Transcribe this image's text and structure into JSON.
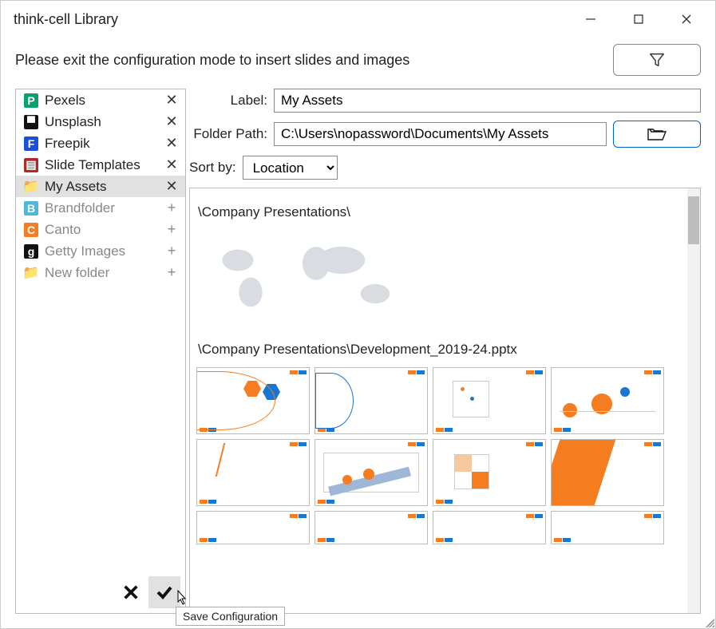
{
  "window": {
    "title": "think-cell Library"
  },
  "instruction": "Please exit the configuration mode to insert slides and images",
  "sidebar": {
    "items": [
      {
        "label": "Pexels",
        "icon_bg": "#0aa06e",
        "icon_char": "P",
        "action": "✕",
        "dim": false,
        "selected": false
      },
      {
        "label": "Unsplash",
        "icon_bg": "#111111",
        "icon_char": "▀",
        "action": "✕",
        "dim": false,
        "selected": false
      },
      {
        "label": "Freepik",
        "icon_bg": "#1e4fd8",
        "icon_char": "F",
        "action": "✕",
        "dim": false,
        "selected": false
      },
      {
        "label": "Slide Templates",
        "icon_bg": "#b02a2a",
        "icon_char": "▤",
        "action": "✕",
        "dim": false,
        "selected": false
      },
      {
        "label": "My Assets",
        "icon_bg": "#f5c04a",
        "icon_char": "📁",
        "action": "✕",
        "dim": false,
        "selected": true
      },
      {
        "label": "Brandfolder",
        "icon_bg": "#4fb7d9",
        "icon_char": "B",
        "action": "+",
        "dim": true,
        "selected": false
      },
      {
        "label": "Canto",
        "icon_bg": "#f57c1f",
        "icon_char": "C",
        "action": "+",
        "dim": true,
        "selected": false
      },
      {
        "label": "Getty Images",
        "icon_bg": "#111111",
        "icon_char": "g",
        "action": "+",
        "dim": true,
        "selected": false
      },
      {
        "label": "New folder",
        "icon_bg": "#f5c04a",
        "icon_char": "📁",
        "action": "+",
        "dim": true,
        "selected": false
      }
    ]
  },
  "fields": {
    "label_caption": "Label:",
    "label_value": "My Assets",
    "path_caption": "Folder Path:",
    "path_value": "C:\\Users\\nopassword\\Documents\\My Assets"
  },
  "sort": {
    "caption": "Sort by:",
    "value": "Location"
  },
  "preview": {
    "group1": "\\Company Presentations\\",
    "group2": "\\Company Presentations\\Development_2019-24.pptx"
  },
  "tooltip": "Save Configuration"
}
